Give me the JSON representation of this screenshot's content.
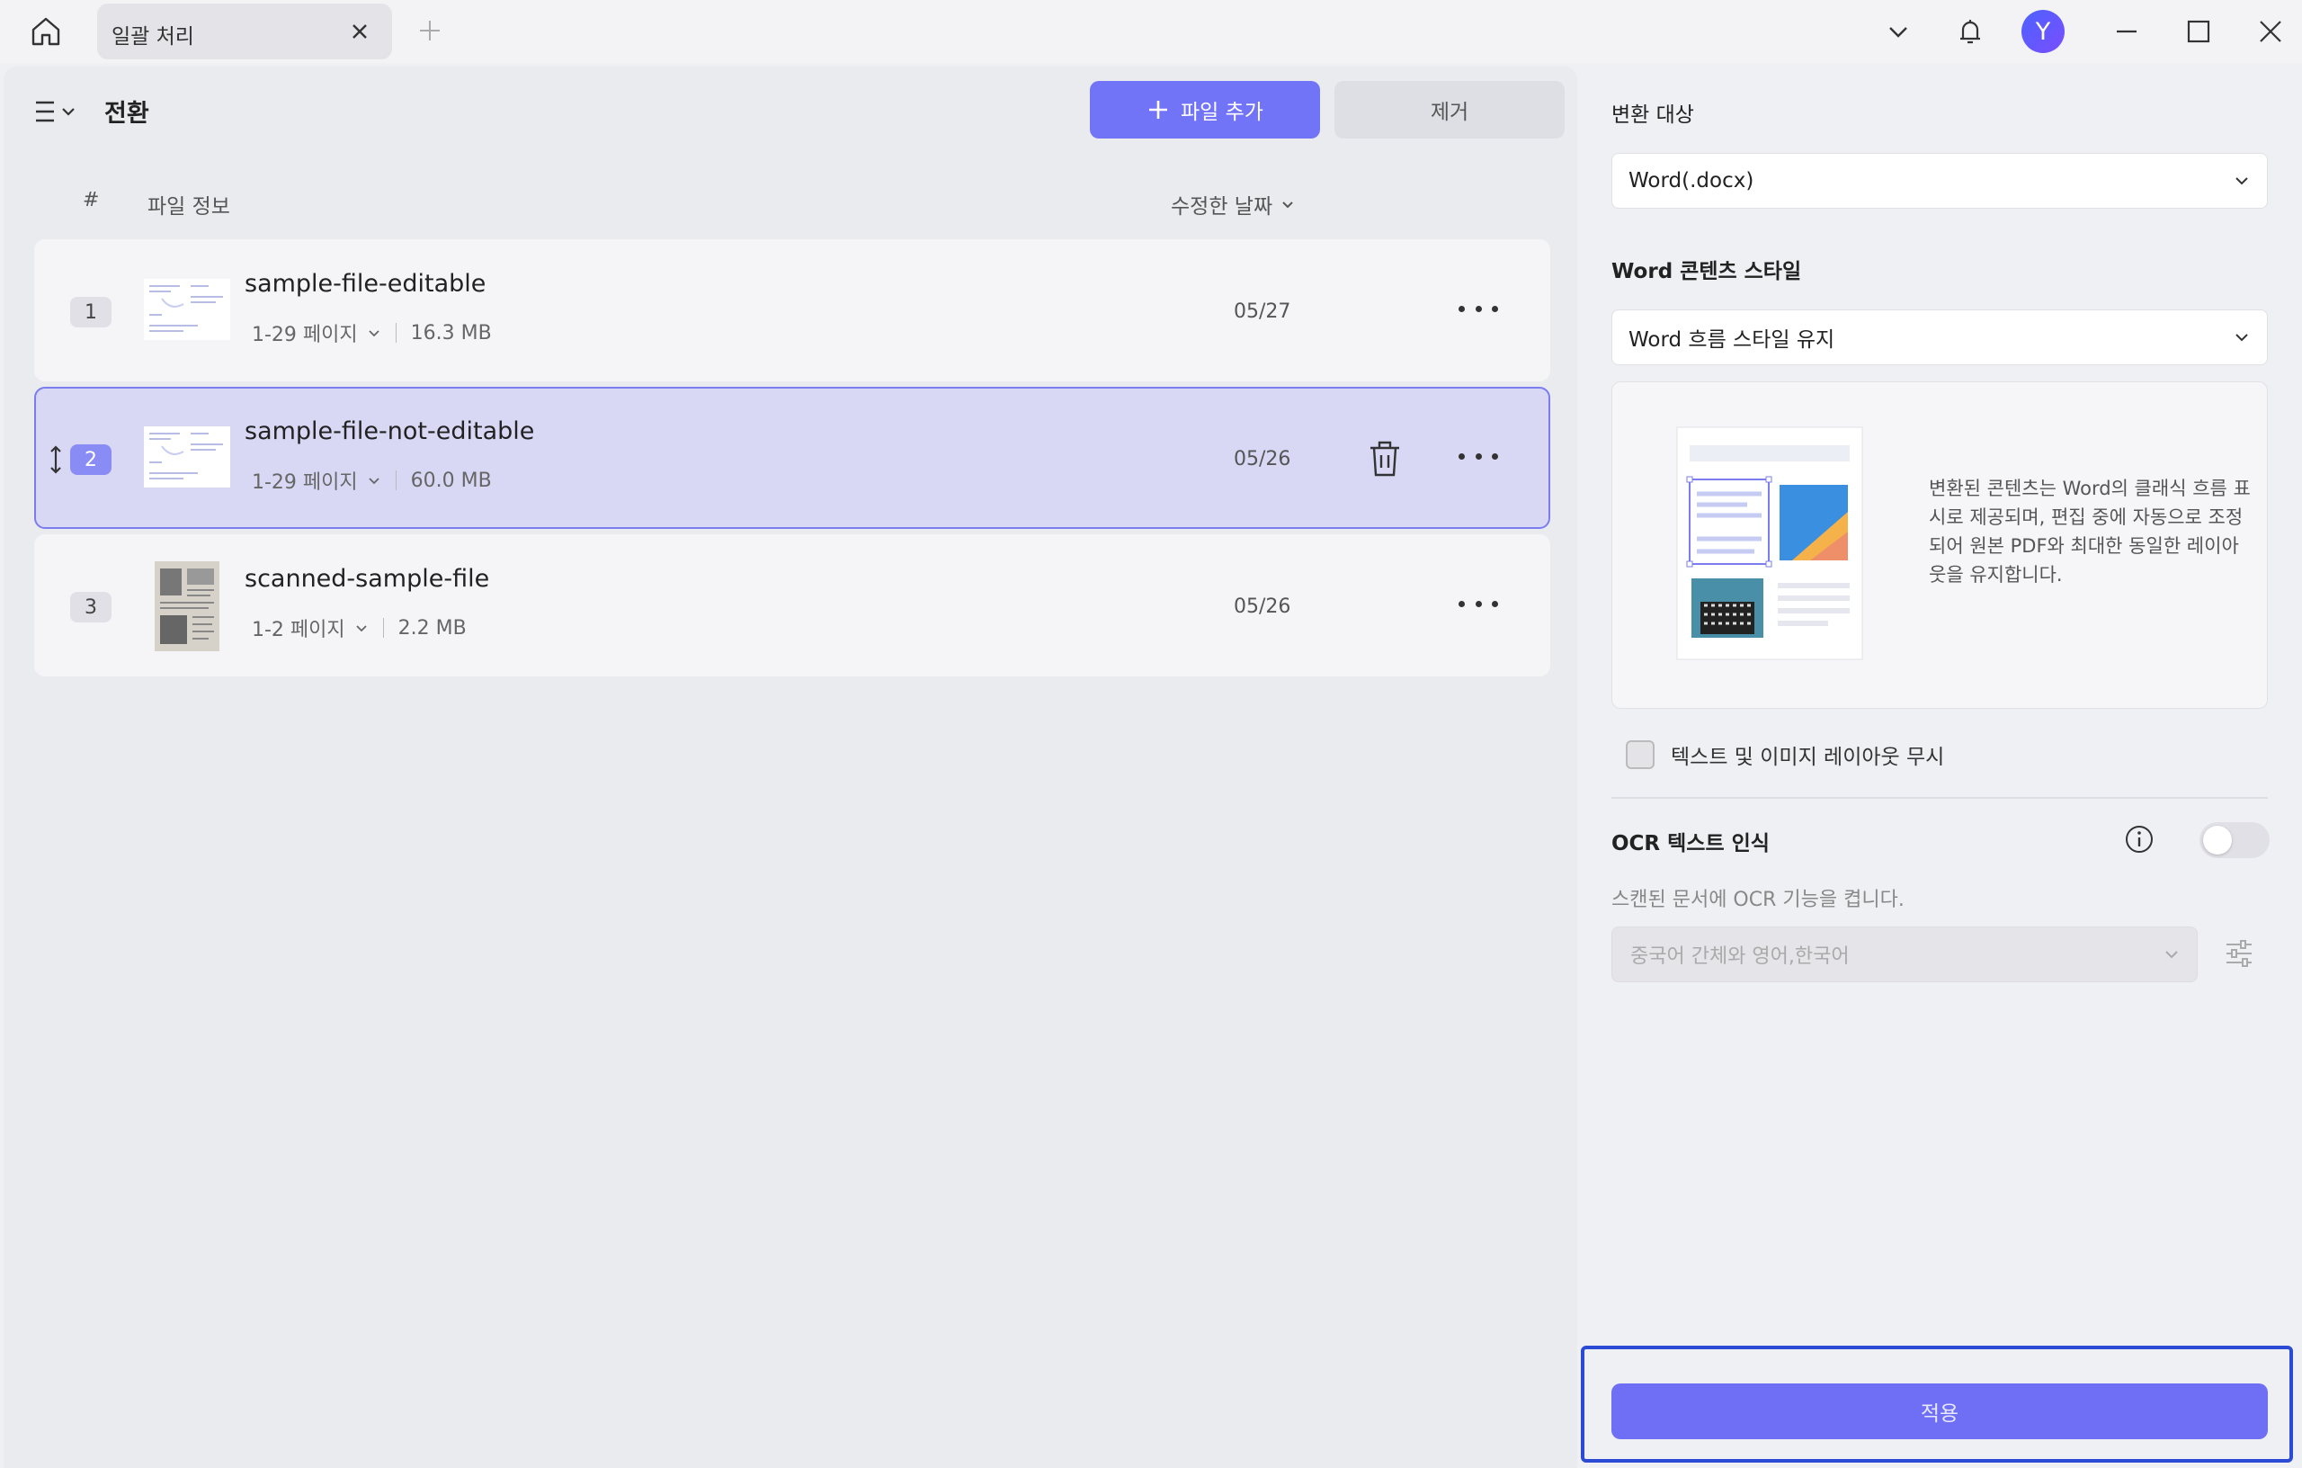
{
  "titlebar": {
    "tab_label": "일괄 처리"
  },
  "avatar_letter": "Y",
  "left": {
    "title": "전환",
    "add_button": "파일 추가",
    "remove_button": "제거",
    "columns": {
      "hash": "#",
      "info": "파일 정보",
      "date": "수정한 날짜"
    },
    "files": [
      {
        "num": "1",
        "name": "sample-file-editable",
        "pages": "1-29 페이지",
        "size": "16.3 MB",
        "date": "05/27"
      },
      {
        "num": "2",
        "name": "sample-file-not-editable",
        "pages": "1-29 페이지",
        "size": "60.0 MB",
        "date": "05/26"
      },
      {
        "num": "3",
        "name": "scanned-sample-file",
        "pages": "1-2 페이지",
        "size": "2.2 MB",
        "date": "05/26"
      }
    ]
  },
  "right": {
    "target_label": "변환 대상",
    "target_value": "Word(.docx)",
    "style_label": "Word 콘텐츠 스타일",
    "style_value": "Word 흐름 스타일 유지",
    "preview_text": "변환된 콘텐츠는 Word의 클래식 흐름 표시로 제공되며, 편집 중에 자동으로 조정되어 원본 PDF와 최대한 동일한 레이아웃을 유지합니다.",
    "checkbox_label": "텍스트 및 이미지 레이아웃 무시",
    "ocr_label": "OCR 텍스트 인식",
    "ocr_desc": "스캔된 문서에 OCR 기능을 켭니다.",
    "ocr_lang": "중국어 간체와 영어,한국어",
    "apply": "적용"
  },
  "colors": {
    "accent": "#7274f8",
    "selected_row": "#d8d8f5",
    "focus_frame": "#2c4bd4"
  }
}
